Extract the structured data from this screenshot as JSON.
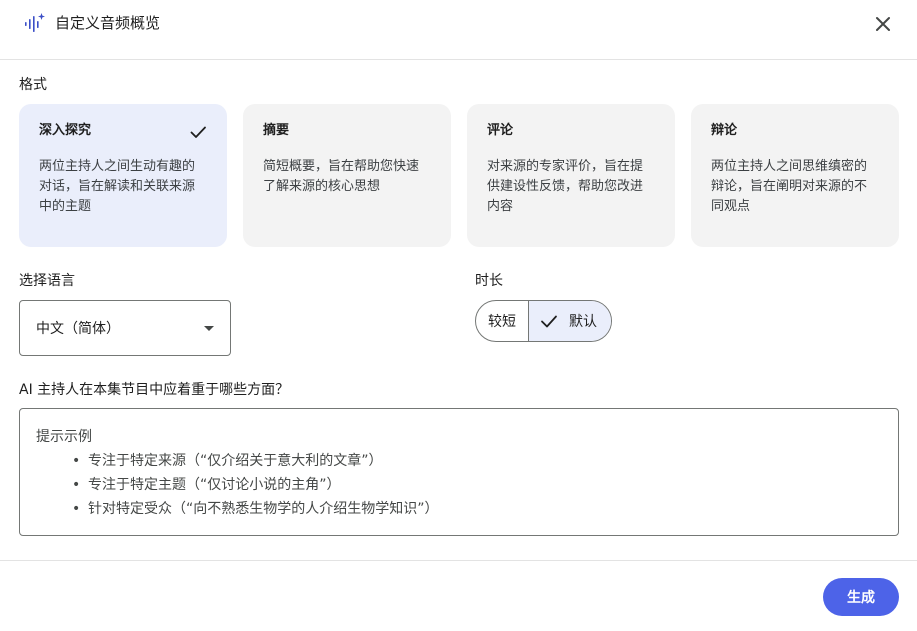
{
  "header": {
    "title": "自定义音频概览",
    "icon": "audio-sparkle-icon",
    "close_icon": "close-icon"
  },
  "format": {
    "label": "格式",
    "cards": [
      {
        "title": "深入探究",
        "desc": "两位主持人之间生动有趣的对话，旨在解读和关联来源中的主题",
        "selected": true
      },
      {
        "title": "摘要",
        "desc": "简短概要，旨在帮助您快速了解来源的核心思想",
        "selected": false
      },
      {
        "title": "评论",
        "desc": "对来源的专家评价，旨在提供建设性反馈，帮助您改进内容",
        "selected": false
      },
      {
        "title": "辩论",
        "desc": "两位主持人之间思维缜密的辩论，旨在阐明对来源的不同观点",
        "selected": false
      }
    ]
  },
  "language": {
    "label": "选择语言",
    "value": "中文（简体）"
  },
  "length": {
    "label": "时长",
    "options": [
      "较短",
      "默认"
    ],
    "selected": "默认"
  },
  "focus": {
    "label": "AI 主持人在本集节目中应着重于哪些方面？",
    "hint_title": "提示示例",
    "hints": [
      "专注于特定来源（“仅介绍关于意大利的文章”）",
      "专注于特定主题（“仅讨论小说的主角”）",
      "针对特定受众（“向不熟悉生物学的人介绍生物学知识”）"
    ]
  },
  "footer": {
    "generate_label": "生成"
  },
  "colors": {
    "accent": "#4d63e8",
    "selected_bg": "#eaeefb",
    "card_bg": "#f3f3f3"
  }
}
